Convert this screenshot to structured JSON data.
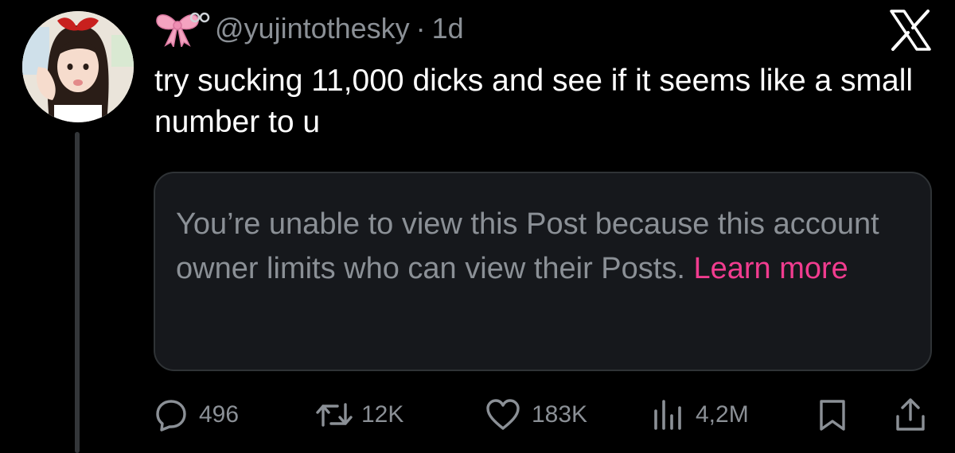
{
  "post": {
    "handle": "@yujintothesky",
    "separator": "·",
    "time": "1d",
    "text": "try sucking 11,000 dicks and see if it seems like a small number to u",
    "name_emoji_icon": "ribbon-bow-icon",
    "avatar_icon": "profile-photo"
  },
  "quoted_post": {
    "message": "You’re unable to view this Post because this account owner limits who can view their Posts.",
    "link_label": "Learn more"
  },
  "actions": {
    "replies": "496",
    "reposts": "12K",
    "likes": "183K",
    "views": "4,2M",
    "reply_icon": "reply-bubble-icon",
    "repost_icon": "repost-icon",
    "like_icon": "heart-icon",
    "views_icon": "views-chart-icon",
    "bookmark_icon": "bookmark-icon",
    "share_icon": "share-icon"
  },
  "branding": {
    "logo": "x-logo-icon"
  },
  "colors": {
    "background": "#000000",
    "text_primary": "#ffffff",
    "text_secondary": "#8b9096",
    "card_background": "#16181c",
    "card_border": "#2f3336",
    "link": "#f13c8f",
    "bow_pink": "#f4a3c0"
  }
}
